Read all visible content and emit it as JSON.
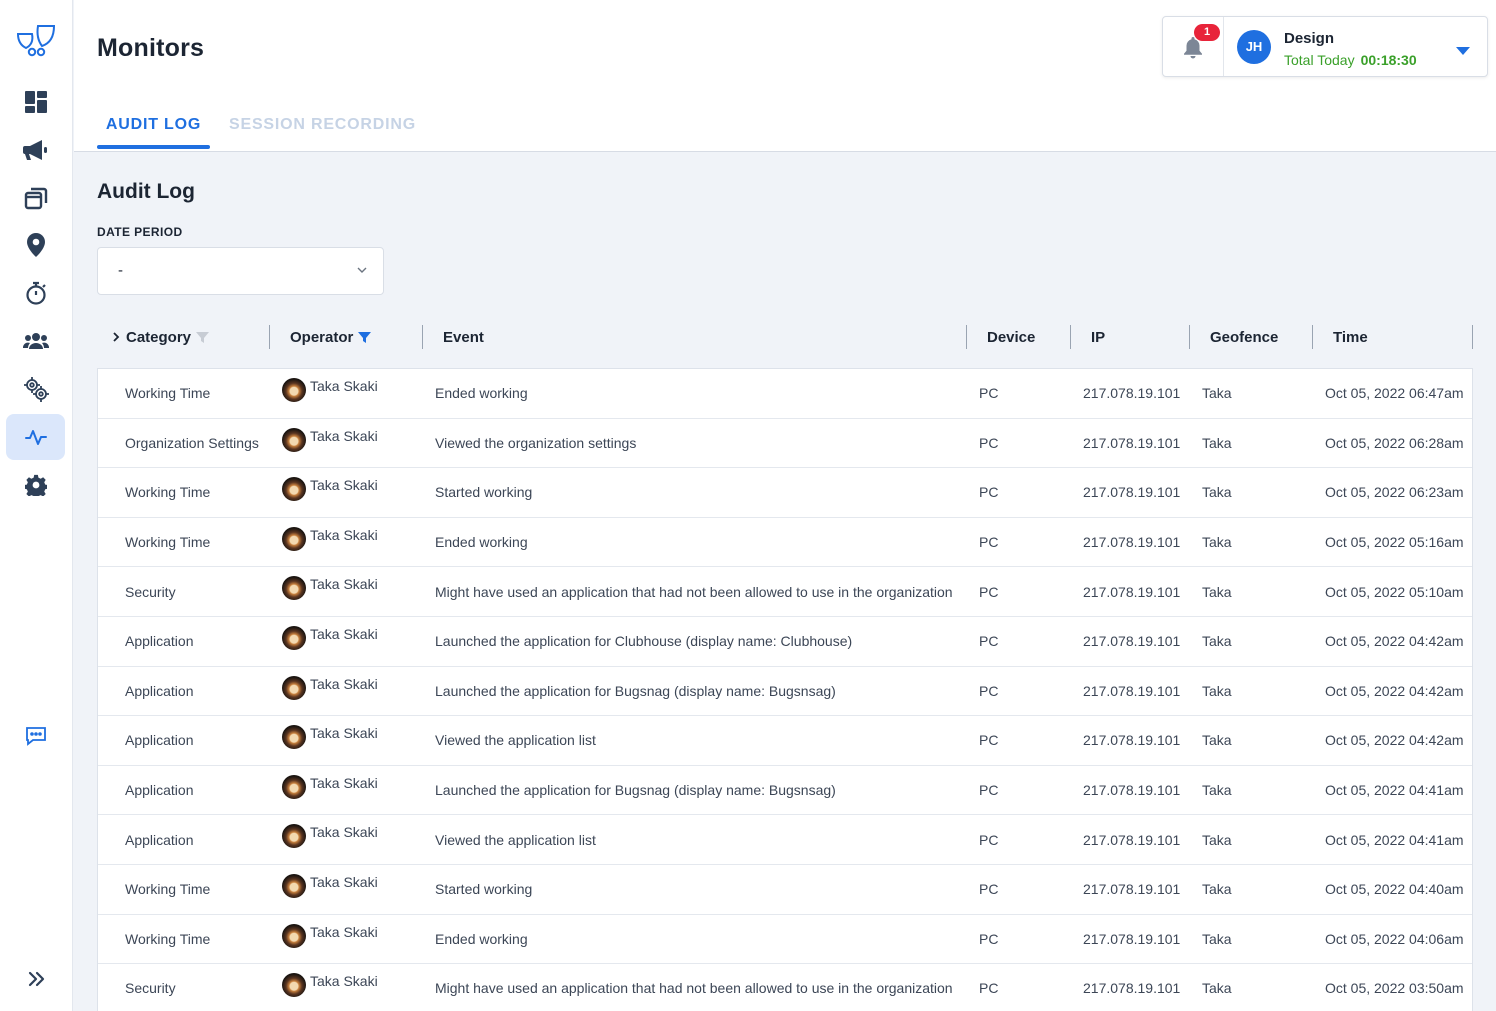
{
  "app": {
    "page_title": "Monitors",
    "tabs": [
      {
        "label": "AUDIT LOG",
        "active": true
      },
      {
        "label": "SESSION RECORDING",
        "active": false
      }
    ]
  },
  "sidebar": {
    "items": [
      {
        "icon": "dashboard-icon"
      },
      {
        "icon": "megaphone-icon"
      },
      {
        "icon": "windows-icon"
      },
      {
        "icon": "location-pin-icon"
      },
      {
        "icon": "stopwatch-icon"
      },
      {
        "icon": "team-icon"
      },
      {
        "icon": "gears-icon"
      },
      {
        "icon": "activity-icon",
        "active": true
      },
      {
        "icon": "settings-icon"
      },
      {
        "icon": "chat-icon"
      },
      {
        "icon": "expand-icon"
      }
    ]
  },
  "user": {
    "notification_count": "1",
    "initials": "JH",
    "name": "Design",
    "total_label": "Total Today",
    "total_time": "00:18:30"
  },
  "audit": {
    "title": "Audit Log",
    "date_period_label": "DATE PERIOD",
    "date_period_value": "-",
    "columns": [
      "Category",
      "Operator",
      "Event",
      "Device",
      "IP",
      "Geofence",
      "Time"
    ],
    "rows": [
      {
        "category": "Working Time",
        "operator": "Taka Skaki",
        "event": "Ended working",
        "device": "PC",
        "ip": "217.078.19.101",
        "geofence": "Taka",
        "time": "Oct 05, 2022 06:47am"
      },
      {
        "category": "Organization Settings",
        "operator": "Taka Skaki",
        "event": "Viewed the organization settings",
        "device": "PC",
        "ip": "217.078.19.101",
        "geofence": "Taka",
        "time": "Oct 05, 2022 06:28am"
      },
      {
        "category": "Working Time",
        "operator": "Taka Skaki",
        "event": "Started working",
        "device": "PC",
        "ip": "217.078.19.101",
        "geofence": "Taka",
        "time": "Oct 05, 2022 06:23am"
      },
      {
        "category": "Working Time",
        "operator": "Taka Skaki",
        "event": "Ended working",
        "device": "PC",
        "ip": "217.078.19.101",
        "geofence": "Taka",
        "time": "Oct 05, 2022 05:16am"
      },
      {
        "category": "Security",
        "operator": "Taka Skaki",
        "event": "Might have used an application that had not been allowed to use in the organization",
        "device": "PC",
        "ip": "217.078.19.101",
        "geofence": "Taka",
        "time": "Oct 05, 2022 05:10am"
      },
      {
        "category": "Application",
        "operator": "Taka Skaki",
        "event": "Launched the application for Clubhouse (display name: Clubhouse)",
        "device": "PC",
        "ip": "217.078.19.101",
        "geofence": "Taka",
        "time": "Oct 05, 2022 04:42am"
      },
      {
        "category": "Application",
        "operator": "Taka Skaki",
        "event": "Launched the application for Bugsnag (display name: Bugsnsag)",
        "device": "PC",
        "ip": "217.078.19.101",
        "geofence": "Taka",
        "time": "Oct 05, 2022 04:42am"
      },
      {
        "category": "Application",
        "operator": "Taka Skaki",
        "event": "Viewed the application list",
        "device": "PC",
        "ip": "217.078.19.101",
        "geofence": "Taka",
        "time": "Oct 05, 2022 04:42am"
      },
      {
        "category": "Application",
        "operator": "Taka Skaki",
        "event": "Launched the application for Bugsnag (display name: Bugsnsag)",
        "device": "PC",
        "ip": "217.078.19.101",
        "geofence": "Taka",
        "time": "Oct 05, 2022 04:41am"
      },
      {
        "category": "Application",
        "operator": "Taka Skaki",
        "event": "Viewed the application list",
        "device": "PC",
        "ip": "217.078.19.101",
        "geofence": "Taka",
        "time": "Oct 05, 2022 04:41am"
      },
      {
        "category": "Working Time",
        "operator": "Taka Skaki",
        "event": "Started working",
        "device": "PC",
        "ip": "217.078.19.101",
        "geofence": "Taka",
        "time": "Oct 05, 2022 04:40am"
      },
      {
        "category": "Working Time",
        "operator": "Taka Skaki",
        "event": "Ended working",
        "device": "PC",
        "ip": "217.078.19.101",
        "geofence": "Taka",
        "time": "Oct 05, 2022 04:06am"
      },
      {
        "category": "Security",
        "operator": "Taka Skaki",
        "event": "Might have used an application that had not been allowed to use in the organization",
        "device": "PC",
        "ip": "217.078.19.101",
        "geofence": "Taka",
        "time": "Oct 05, 2022 03:50am"
      }
    ]
  },
  "colors": {
    "accent": "#1f6fe0",
    "badge": "#e8243a",
    "time_green": "#3aa02a",
    "icon_dark": "#2e4058"
  }
}
